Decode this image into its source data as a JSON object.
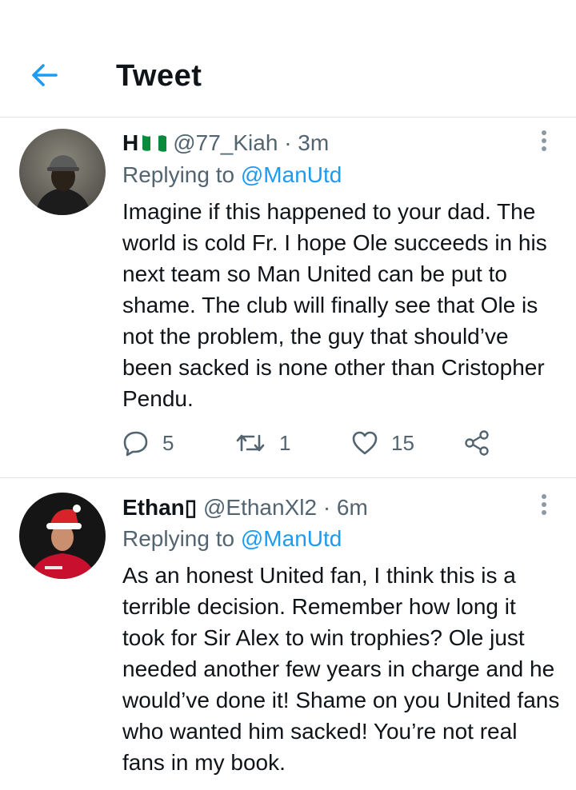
{
  "header": {
    "title": "Tweet"
  },
  "tweets": [
    {
      "name": "H",
      "flag": "nigeria-flag",
      "handle": "@77_Kiah",
      "time": "· 3m",
      "reply_prefix": "Replying to",
      "reply_to": "@ManUtd",
      "body": "Imagine if this happened to your dad. The world is cold Fr. I hope Ole succeeds in his next team so Man United can be put to shame. The club will finally see that Ole is not the problem, the guy that should’ve been sacked is none other than Cristopher Pendu.",
      "replies": "5",
      "retweets": "1",
      "likes": "15"
    },
    {
      "name": "Ethan▯",
      "handle": "@EthanXl2",
      "time": "· 6m",
      "reply_prefix": "Replying to",
      "reply_to": "@ManUtd",
      "body": "As an honest United fan, I think this is a terrible decision. Remember how long it took for Sir Alex to win trophies? Ole just needed another few years in charge and he would’ve done it! Shame on you United fans who wanted him sacked! You’re not real fans in my book."
    }
  ],
  "colors": {
    "accent": "#1d9bf0",
    "secondary_text": "#536471",
    "divider": "#e3e6e8"
  }
}
